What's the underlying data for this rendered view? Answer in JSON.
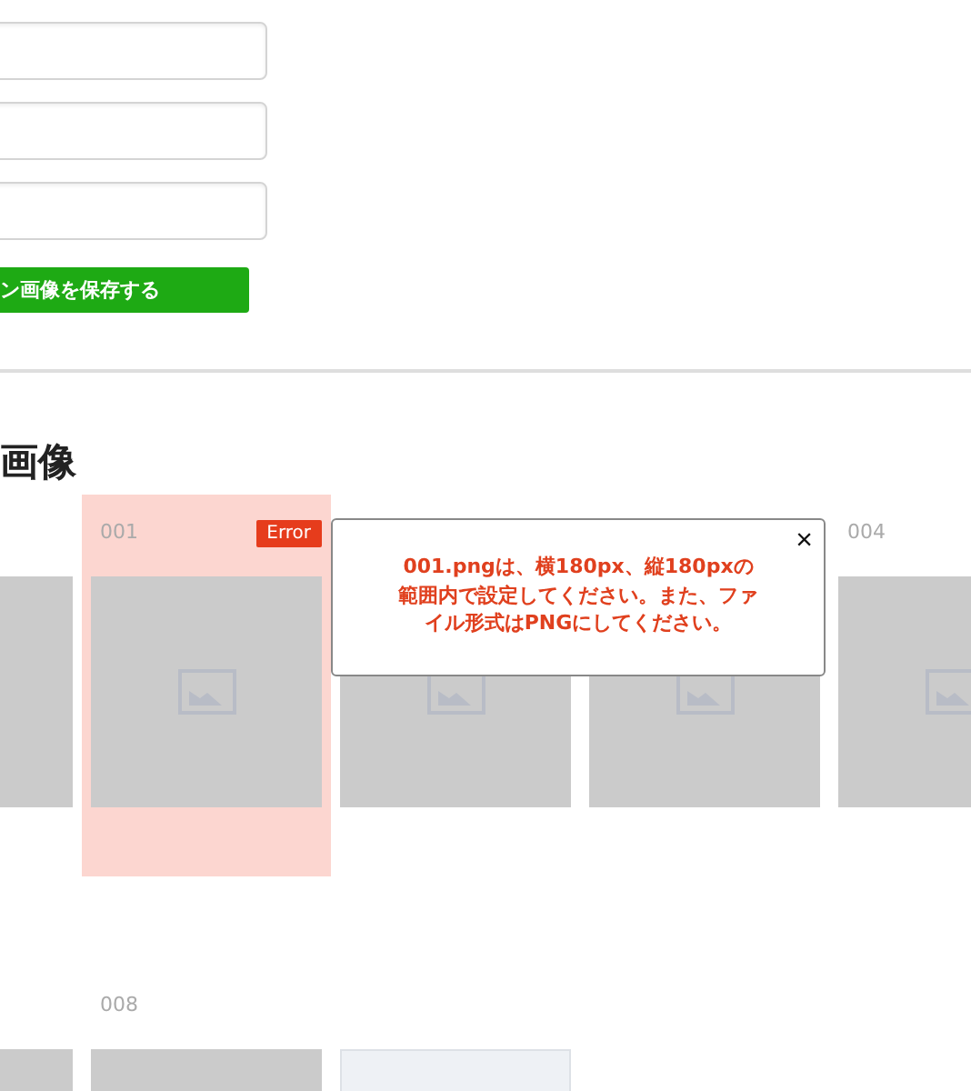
{
  "form": {
    "fields": [
      {
        "kind": "input"
      },
      {
        "kind": "input"
      },
      {
        "kind": "input"
      }
    ],
    "save_button": "ン画像を保存する"
  },
  "section": {
    "title": "画像"
  },
  "rows": [
    {
      "cells": [
        {
          "kind": "blank",
          "error": false
        },
        {
          "kind": "image",
          "label": "001",
          "error": true,
          "badge": "Error"
        },
        {
          "kind": "image",
          "error": false
        },
        {
          "kind": "image",
          "error": false
        },
        {
          "kind": "image",
          "label": "004",
          "error": false
        }
      ]
    },
    {
      "cells": [
        {
          "kind": "blank",
          "error": false
        },
        {
          "kind": "blank",
          "label": "008",
          "error": false
        },
        {
          "kind": "empty",
          "error": false
        }
      ]
    }
  ],
  "error_popup": {
    "message": "001.pngは、横180px、縦180pxの範囲内で設定してください。また、ファイル形式はPNGにしてください。",
    "close": "×"
  }
}
